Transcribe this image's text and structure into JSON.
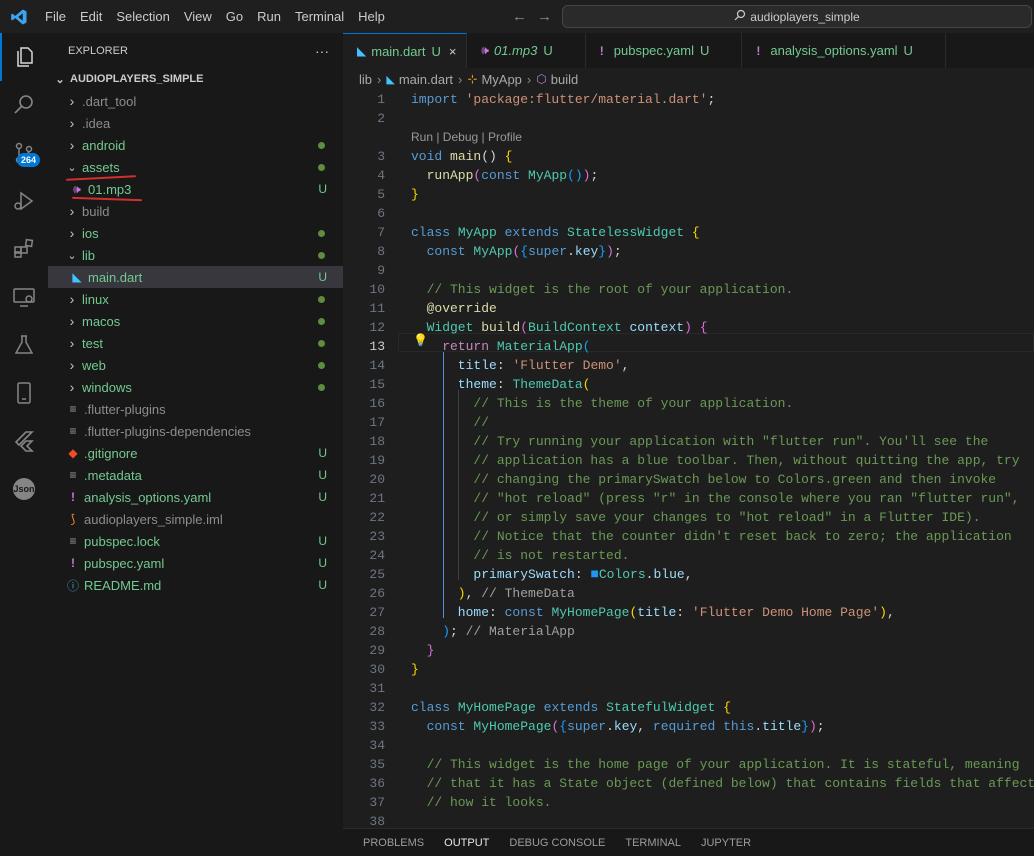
{
  "menu": [
    "File",
    "Edit",
    "Selection",
    "View",
    "Go",
    "Run",
    "Terminal",
    "Help"
  ],
  "search": {
    "text": "audioplayers_simple"
  },
  "activity": {
    "source_control_badge": "264",
    "json_label": "Json"
  },
  "explorer": {
    "title": "EXPLORER",
    "more": "···",
    "root": "AUDIOPLAYERS_SIMPLE"
  },
  "files": [
    {
      "name": ".dart_tool",
      "kind": "folder",
      "open": false,
      "depth": 1,
      "color": "#8c8c8c",
      "status": "",
      "dot": false
    },
    {
      "name": ".idea",
      "kind": "folder",
      "open": false,
      "depth": 1,
      "color": "#8c8c8c",
      "status": "",
      "dot": false
    },
    {
      "name": "android",
      "kind": "folder",
      "open": false,
      "depth": 1,
      "color": "#73c991",
      "status": "",
      "dot": true
    },
    {
      "name": "assets",
      "kind": "folder",
      "open": true,
      "depth": 1,
      "color": "#73c991",
      "status": "",
      "dot": true
    },
    {
      "name": "01.mp3",
      "kind": "audio",
      "depth": 2,
      "color": "#73c991",
      "status": "U",
      "dot": false
    },
    {
      "name": "build",
      "kind": "folder",
      "open": false,
      "depth": 1,
      "color": "#8c8c8c",
      "status": "",
      "dot": false
    },
    {
      "name": "ios",
      "kind": "folder",
      "open": false,
      "depth": 1,
      "color": "#73c991",
      "status": "",
      "dot": true
    },
    {
      "name": "lib",
      "kind": "folder",
      "open": true,
      "depth": 1,
      "color": "#73c991",
      "status": "",
      "dot": true
    },
    {
      "name": "main.dart",
      "kind": "dart",
      "depth": 2,
      "color": "#73c991",
      "status": "U",
      "dot": false,
      "selected": true
    },
    {
      "name": "linux",
      "kind": "folder",
      "open": false,
      "depth": 1,
      "color": "#73c991",
      "status": "",
      "dot": true
    },
    {
      "name": "macos",
      "kind": "folder",
      "open": false,
      "depth": 1,
      "color": "#73c991",
      "status": "",
      "dot": true
    },
    {
      "name": "test",
      "kind": "folder",
      "open": false,
      "depth": 1,
      "color": "#73c991",
      "status": "",
      "dot": true
    },
    {
      "name": "web",
      "kind": "folder",
      "open": false,
      "depth": 1,
      "color": "#73c991",
      "status": "",
      "dot": true
    },
    {
      "name": "windows",
      "kind": "folder",
      "open": false,
      "depth": 1,
      "color": "#73c991",
      "status": "",
      "dot": true
    },
    {
      "name": ".flutter-plugins",
      "kind": "lines",
      "depth": 1,
      "color": "#8c8c8c",
      "status": "",
      "dot": false
    },
    {
      "name": ".flutter-plugins-dependencies",
      "kind": "lines",
      "depth": 1,
      "color": "#8c8c8c",
      "status": "",
      "dot": false
    },
    {
      "name": ".gitignore",
      "kind": "git",
      "depth": 1,
      "color": "#73c991",
      "status": "U",
      "dot": false
    },
    {
      "name": ".metadata",
      "kind": "lines",
      "depth": 1,
      "color": "#73c991",
      "status": "U",
      "dot": false
    },
    {
      "name": "analysis_options.yaml",
      "kind": "yaml",
      "depth": 1,
      "color": "#73c991",
      "status": "U",
      "dot": false
    },
    {
      "name": "audioplayers_simple.iml",
      "kind": "rss",
      "depth": 1,
      "color": "#8c8c8c",
      "status": "",
      "dot": false
    },
    {
      "name": "pubspec.lock",
      "kind": "lines",
      "depth": 1,
      "color": "#73c991",
      "status": "U",
      "dot": false
    },
    {
      "name": "pubspec.yaml",
      "kind": "yaml",
      "depth": 1,
      "color": "#73c991",
      "status": "U",
      "dot": false
    },
    {
      "name": "README.md",
      "kind": "info",
      "depth": 1,
      "color": "#73c991",
      "status": "U",
      "dot": false
    }
  ],
  "tabs": [
    {
      "name": "main.dart",
      "kind": "dart",
      "status": "U",
      "active": true,
      "italic": false
    },
    {
      "name": "01.mp3",
      "kind": "audio",
      "status": "U",
      "active": false,
      "italic": true
    },
    {
      "name": "pubspec.yaml",
      "kind": "yaml",
      "status": "U",
      "active": false,
      "italic": false
    },
    {
      "name": "analysis_options.yaml",
      "kind": "yaml",
      "status": "U",
      "active": false,
      "italic": false
    }
  ],
  "tab_close": "×",
  "breadcrumb": [
    "lib",
    "main.dart",
    "MyApp",
    "build"
  ],
  "codelens": "Run | Debug | Profile",
  "current_line": 13,
  "code_lines": [
    {
      "n": 1,
      "t": [
        [
          "import ",
          "#569cd6"
        ],
        [
          "'package:flutter/material.dart'",
          "#ce9178"
        ],
        [
          ";",
          "#d4d4d4"
        ]
      ]
    },
    {
      "n": 2,
      "t": []
    },
    {
      "n": 3,
      "t": [
        [
          "void ",
          "#569cd6"
        ],
        [
          "main",
          "#dcdcaa"
        ],
        [
          "() ",
          "#d4d4d4"
        ],
        [
          "{",
          "#ffd700"
        ]
      ]
    },
    {
      "n": 4,
      "t": [
        [
          "  runApp",
          "#dcdcaa"
        ],
        [
          "(",
          "#da70d6"
        ],
        [
          "const ",
          "#569cd6"
        ],
        [
          "MyApp",
          "#4ec9b0"
        ],
        [
          "()",
          "#179fff"
        ],
        [
          ")",
          "#da70d6"
        ],
        [
          ";",
          "#d4d4d4"
        ]
      ]
    },
    {
      "n": 5,
      "t": [
        [
          "}",
          "#ffd700"
        ]
      ]
    },
    {
      "n": 6,
      "t": []
    },
    {
      "n": 7,
      "t": [
        [
          "class ",
          "#569cd6"
        ],
        [
          "MyApp ",
          "#4ec9b0"
        ],
        [
          "extends ",
          "#569cd6"
        ],
        [
          "StatelessWidget ",
          "#4ec9b0"
        ],
        [
          "{",
          "#ffd700"
        ]
      ]
    },
    {
      "n": 8,
      "t": [
        [
          "  const ",
          "#569cd6"
        ],
        [
          "MyApp",
          "#4ec9b0"
        ],
        [
          "(",
          "#da70d6"
        ],
        [
          "{",
          "#179fff"
        ],
        [
          "super",
          "#569cd6"
        ],
        [
          ".",
          "#d4d4d4"
        ],
        [
          "key",
          "#9cdcfe"
        ],
        [
          "}",
          "#179fff"
        ],
        [
          ")",
          "#da70d6"
        ],
        [
          ";",
          "#d4d4d4"
        ]
      ]
    },
    {
      "n": 9,
      "t": []
    },
    {
      "n": 10,
      "t": [
        [
          "  // This widget is the root of your application.",
          "#6a9955"
        ]
      ]
    },
    {
      "n": 11,
      "t": [
        [
          "  @override",
          "#dcdcaa"
        ]
      ]
    },
    {
      "n": 12,
      "t": [
        [
          "  Widget ",
          "#4ec9b0"
        ],
        [
          "build",
          "#dcdcaa"
        ],
        [
          "(",
          "#da70d6"
        ],
        [
          "BuildContext ",
          "#4ec9b0"
        ],
        [
          "context",
          "#9cdcfe"
        ],
        [
          ") ",
          "#da70d6"
        ],
        [
          "{",
          "#da70d6"
        ]
      ]
    },
    {
      "n": 13,
      "t": [
        [
          "    return ",
          "#c586c0"
        ],
        [
          "MaterialApp",
          "#4ec9b0"
        ],
        [
          "(",
          "#179fff"
        ]
      ]
    },
    {
      "n": 14,
      "t": [
        [
          "      title",
          "#9cdcfe"
        ],
        [
          ": ",
          "#d4d4d4"
        ],
        [
          "'Flutter Demo'",
          "#ce9178"
        ],
        [
          ",",
          "#d4d4d4"
        ]
      ]
    },
    {
      "n": 15,
      "t": [
        [
          "      theme",
          "#9cdcfe"
        ],
        [
          ": ",
          "#d4d4d4"
        ],
        [
          "ThemeData",
          "#4ec9b0"
        ],
        [
          "(",
          "#ffd700"
        ]
      ]
    },
    {
      "n": 16,
      "t": [
        [
          "        // This is the theme of your application.",
          "#6a9955"
        ]
      ]
    },
    {
      "n": 17,
      "t": [
        [
          "        //",
          "#6a9955"
        ]
      ]
    },
    {
      "n": 18,
      "t": [
        [
          "        // Try running your application with \"flutter run\". You'll see the",
          "#6a9955"
        ]
      ]
    },
    {
      "n": 19,
      "t": [
        [
          "        // application has a blue toolbar. Then, without quitting the app, try",
          "#6a9955"
        ]
      ]
    },
    {
      "n": 20,
      "t": [
        [
          "        // changing the primarySwatch below to Colors.green and then invoke",
          "#6a9955"
        ]
      ]
    },
    {
      "n": 21,
      "t": [
        [
          "        // \"hot reload\" (press \"r\" in the console where you ran \"flutter run\",",
          "#6a9955"
        ]
      ]
    },
    {
      "n": 22,
      "t": [
        [
          "        // or simply save your changes to \"hot reload\" in a Flutter IDE).",
          "#6a9955"
        ]
      ]
    },
    {
      "n": 23,
      "t": [
        [
          "        // Notice that the counter didn't reset back to zero; the application",
          "#6a9955"
        ]
      ]
    },
    {
      "n": 24,
      "t": [
        [
          "        // is not restarted.",
          "#6a9955"
        ]
      ]
    },
    {
      "n": 25,
      "t": [
        [
          "        primarySwatch",
          "#9cdcfe"
        ],
        [
          ": ",
          "#d4d4d4"
        ],
        [
          "■",
          "#2196f3"
        ],
        [
          "Colors",
          "#4ec9b0"
        ],
        [
          ".",
          "#d4d4d4"
        ],
        [
          "blue",
          "#9cdcfe"
        ],
        [
          ",",
          "#d4d4d4"
        ]
      ]
    },
    {
      "n": 26,
      "t": [
        [
          "      )",
          "#ffd700"
        ],
        [
          ", ",
          "#d4d4d4"
        ],
        [
          "// ThemeData",
          "#a0a0a0"
        ]
      ]
    },
    {
      "n": 27,
      "t": [
        [
          "      home",
          "#9cdcfe"
        ],
        [
          ": ",
          "#d4d4d4"
        ],
        [
          "const ",
          "#569cd6"
        ],
        [
          "MyHomePage",
          "#4ec9b0"
        ],
        [
          "(",
          "#ffd700"
        ],
        [
          "title",
          "#9cdcfe"
        ],
        [
          ": ",
          "#d4d4d4"
        ],
        [
          "'Flutter Demo Home Page'",
          "#ce9178"
        ],
        [
          ")",
          "#ffd700"
        ],
        [
          ",",
          "#d4d4d4"
        ]
      ]
    },
    {
      "n": 28,
      "t": [
        [
          "    )",
          "#179fff"
        ],
        [
          "; ",
          "#d4d4d4"
        ],
        [
          "// MaterialApp",
          "#a0a0a0"
        ]
      ]
    },
    {
      "n": 29,
      "t": [
        [
          "  }",
          "#da70d6"
        ]
      ]
    },
    {
      "n": 30,
      "t": [
        [
          "}",
          "#ffd700"
        ]
      ]
    },
    {
      "n": 31,
      "t": []
    },
    {
      "n": 32,
      "t": [
        [
          "class ",
          "#569cd6"
        ],
        [
          "MyHomePage ",
          "#4ec9b0"
        ],
        [
          "extends ",
          "#569cd6"
        ],
        [
          "StatefulWidget ",
          "#4ec9b0"
        ],
        [
          "{",
          "#ffd700"
        ]
      ]
    },
    {
      "n": 33,
      "t": [
        [
          "  const ",
          "#569cd6"
        ],
        [
          "MyHomePage",
          "#4ec9b0"
        ],
        [
          "(",
          "#da70d6"
        ],
        [
          "{",
          "#179fff"
        ],
        [
          "super",
          "#569cd6"
        ],
        [
          ".",
          "#d4d4d4"
        ],
        [
          "key",
          "#9cdcfe"
        ],
        [
          ", ",
          "#d4d4d4"
        ],
        [
          "required ",
          "#569cd6"
        ],
        [
          "this",
          "#569cd6"
        ],
        [
          ".",
          "#d4d4d4"
        ],
        [
          "title",
          "#9cdcfe"
        ],
        [
          "}",
          "#179fff"
        ],
        [
          ")",
          "#da70d6"
        ],
        [
          ";",
          "#d4d4d4"
        ]
      ]
    },
    {
      "n": 34,
      "t": []
    },
    {
      "n": 35,
      "t": [
        [
          "  // This widget is the home page of your application. It is stateful, meaning",
          "#6a9955"
        ]
      ]
    },
    {
      "n": 36,
      "t": [
        [
          "  // that it has a State object (defined below) that contains fields that affect",
          "#6a9955"
        ]
      ]
    },
    {
      "n": 37,
      "t": [
        [
          "  // how it looks.",
          "#6a9955"
        ]
      ]
    },
    {
      "n": 38,
      "t": []
    }
  ],
  "panel_tabs": [
    {
      "label": "PROBLEMS",
      "active": false
    },
    {
      "label": "OUTPUT",
      "active": true
    },
    {
      "label": "DEBUG CONSOLE",
      "active": false
    },
    {
      "label": "TERMINAL",
      "active": false
    },
    {
      "label": "JUPYTER",
      "active": false
    }
  ],
  "colors": {
    "accent": "#0078d4",
    "untracked": "#73c991",
    "annotation": "#d32f2f"
  }
}
